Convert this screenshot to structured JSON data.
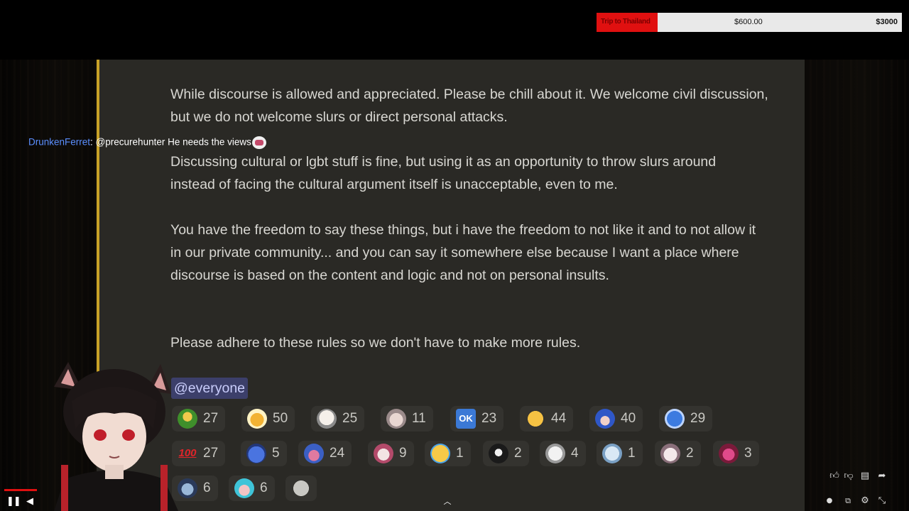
{
  "goal": {
    "title": "Trip to Thailand",
    "current": "$600.00",
    "target": "$3000",
    "progress_fraction": 0.2,
    "fill_color": "#e01010"
  },
  "message": {
    "paragraphs": [
      "While discourse is allowed and appreciated. Please be chill about it. We welcome civil discussion, but we do not welcome slurs or direct personal attacks.",
      "Discussing cultural or lgbt stuff is fine, but using it as an opportunity to throw slurs around instead of facing the cultural argument itself is unacceptable, even to me.",
      "You have the freedom to say these things, but i have the freedom to not like it and to not allow it in our private community... and you can say it somewhere else because I want a place where discourse is based on the content and logic and not on personal insults.",
      "Please adhere to these rules so we don't have to make more rules."
    ],
    "mention": "@everyone",
    "accent_color": "#c9a227"
  },
  "reactions": {
    "row1": [
      {
        "icon": "bottle-emoji-icon",
        "count": "27"
      },
      {
        "icon": "beer-mugs-emoji-icon",
        "count": "50"
      },
      {
        "icon": "anime-face-emoji-icon",
        "count": "25"
      },
      {
        "icon": "angel-face-emoji-icon",
        "count": "11"
      },
      {
        "icon": "ok-emoji-icon",
        "label": "OK",
        "count": "23"
      },
      {
        "icon": "thumbs-up-emoji-icon",
        "count": "44"
      },
      {
        "icon": "blue-character-emoji-icon",
        "count": "40"
      },
      {
        "icon": "blue-bird-emoji-icon",
        "count": "29"
      }
    ],
    "row2": [
      {
        "icon": "hundred-emoji-icon",
        "label": "100",
        "count": "27"
      },
      {
        "icon": "blue-blob-emoji-icon",
        "count": "5"
      },
      {
        "icon": "pink-hair-emoji-icon",
        "count": "24"
      },
      {
        "icon": "cat-girl-emoji-icon",
        "count": "9"
      },
      {
        "icon": "laughing-tears-emoji-icon",
        "count": "1"
      },
      {
        "icon": "dark-figure-emoji-icon",
        "count": "2"
      },
      {
        "icon": "white-cat-emoji-icon",
        "count": "4"
      },
      {
        "icon": "ghost-emoji-icon",
        "count": "1"
      },
      {
        "icon": "maid-emoji-icon",
        "count": "2"
      },
      {
        "icon": "red-character-emoji-icon",
        "count": "3"
      }
    ],
    "row3": [
      {
        "icon": "hood-emoji-icon",
        "count": "6"
      },
      {
        "icon": "cyan-hair-emoji-icon",
        "count": "6"
      },
      {
        "icon": "add-reaction-icon",
        "count": ""
      }
    ]
  },
  "chat": {
    "username": "DrunkenFerret",
    "separator": ":",
    "message": "@precurehunter He needs the views",
    "emote": "chat-emote-icon"
  },
  "player": {
    "pause_icon": "pause-icon",
    "volume_icon": "volume-icon",
    "expand_icon": "chevron-up-icon",
    "like_icon": "thumbs-up-icon",
    "dislike_icon": "thumbs-down-icon",
    "comment_icon": "comment-icon",
    "share_icon": "share-icon",
    "autoplay_icon": "autoplay-toggle-icon",
    "captions_icon": "captions-icon",
    "settings_icon": "settings-gear-icon",
    "collapse_icon": "exit-fullscreen-icon"
  }
}
